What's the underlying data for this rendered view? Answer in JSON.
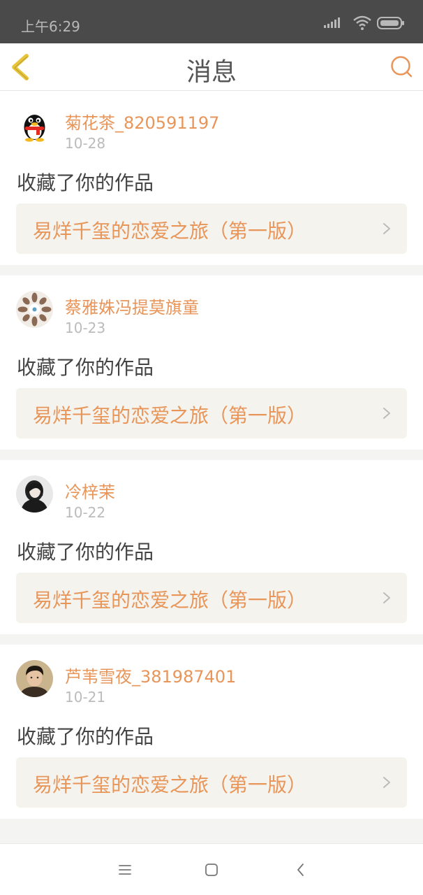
{
  "status_bar": {
    "time": "上午6:29"
  },
  "header": {
    "title": "消息"
  },
  "messages": [
    {
      "username": "菊花茶_820591197",
      "date": "10-28",
      "action": "收藏了你的作品",
      "work_title": "易烊千玺的恋爱之旅（第一版）"
    },
    {
      "username": "蔡雅姝冯提莫旗童",
      "date": "10-23",
      "action": "收藏了你的作品",
      "work_title": "易烊千玺的恋爱之旅（第一版）"
    },
    {
      "username": "冷梓茉",
      "date": "10-22",
      "action": "收藏了你的作品",
      "work_title": "易烊千玺的恋爱之旅（第一版）"
    },
    {
      "username": "芦苇雪夜_381987401",
      "date": "10-21",
      "action": "收藏了你的作品",
      "work_title": "易烊千玺的恋爱之旅（第一版）"
    }
  ],
  "colors": {
    "accent": "#e8955a",
    "back_arrow": "#e8c53a",
    "status_bar": "#4a4a4a"
  },
  "icons": {
    "back": "chevron-left-icon",
    "search": "search-icon"
  }
}
